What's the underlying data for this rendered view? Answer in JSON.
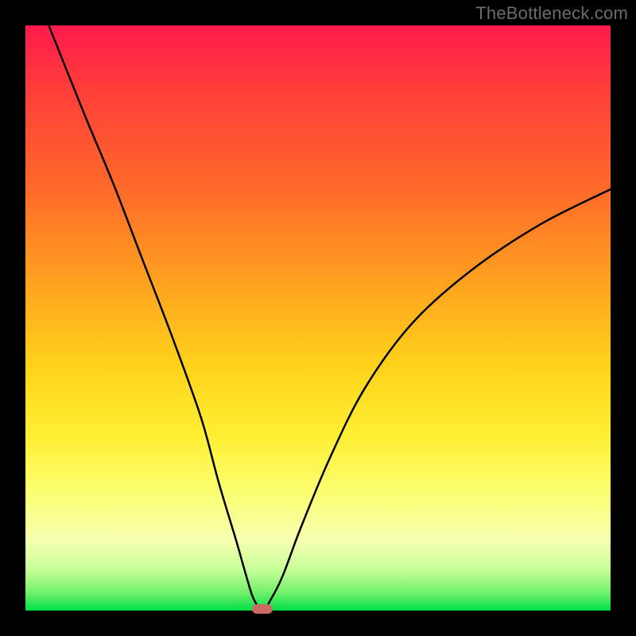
{
  "watermark": "TheBottleneck.com",
  "colors": {
    "background": "#000000",
    "gradient_top": "#ff1a4d",
    "gradient_mid": "#ffd21a",
    "gradient_bottom": "#00e047",
    "curve": "#000000",
    "marker": "#cc6b66"
  },
  "chart_data": {
    "type": "line",
    "title": "",
    "xlabel": "",
    "ylabel": "",
    "xlim": [
      0,
      100
    ],
    "ylim": [
      0,
      100
    ],
    "grid": false,
    "legend": "none",
    "series": [
      {
        "name": "bottleneck-curve",
        "x": [
          4,
          10,
          15,
          20,
          25,
          30,
          33,
          36,
          38,
          39,
          40.5,
          42,
          44,
          47,
          52,
          58,
          66,
          76,
          88,
          100
        ],
        "values": [
          100,
          85,
          73,
          60,
          47,
          33,
          22,
          12,
          5,
          2,
          0,
          2,
          6,
          14,
          26,
          38,
          49,
          58,
          66,
          72
        ]
      }
    ],
    "marker": {
      "x": 40.5,
      "y": 0,
      "shape": "rounded-rect"
    },
    "notes": "V-shaped curve on a vertical heat gradient; minimum touches the bottom near x≈40."
  }
}
